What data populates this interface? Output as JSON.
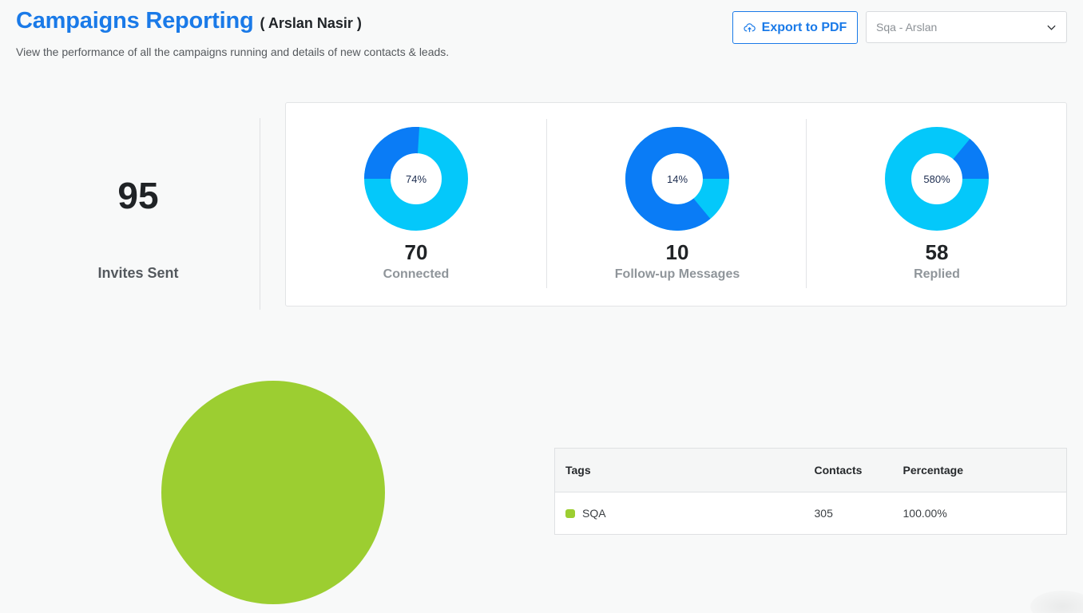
{
  "header": {
    "title": "Campaigns Reporting",
    "user": "( Arslan Nasir )",
    "subtitle": "View the performance of all the campaigns running and details of new contacts & leads.",
    "export_label": "Export to PDF",
    "select_value": "Sqa - Arslan"
  },
  "invites": {
    "value": "95",
    "label": "Invites Sent"
  },
  "colors": {
    "primary": "#0a7cf6",
    "secondary": "#04c8fa",
    "tag_green": "#9cce31",
    "title_blue": "#1a7ae8"
  },
  "stats": [
    {
      "value": "70",
      "label": "Connected",
      "percent_label": "74%",
      "primary_fraction": 0.26,
      "primary_start": 0.75
    },
    {
      "value": "10",
      "label": "Follow-up Messages",
      "percent_label": "14%",
      "primary_fraction": 0.86,
      "primary_start": 0.39
    },
    {
      "value": "58",
      "label": "Replied",
      "percent_label": "580%",
      "primary_fraction": 0.14,
      "primary_start": 0.11
    }
  ],
  "tags_table": {
    "headers": [
      "Tags",
      "Contacts",
      "Percentage"
    ],
    "rows": [
      {
        "tag": "SQA",
        "contacts": "305",
        "percentage": "100.00%",
        "color": "#9cce31"
      }
    ]
  },
  "chart_data": {
    "type": "pie",
    "categories": [
      "SQA"
    ],
    "values": [
      305
    ],
    "colors": [
      "#9cce31"
    ]
  }
}
